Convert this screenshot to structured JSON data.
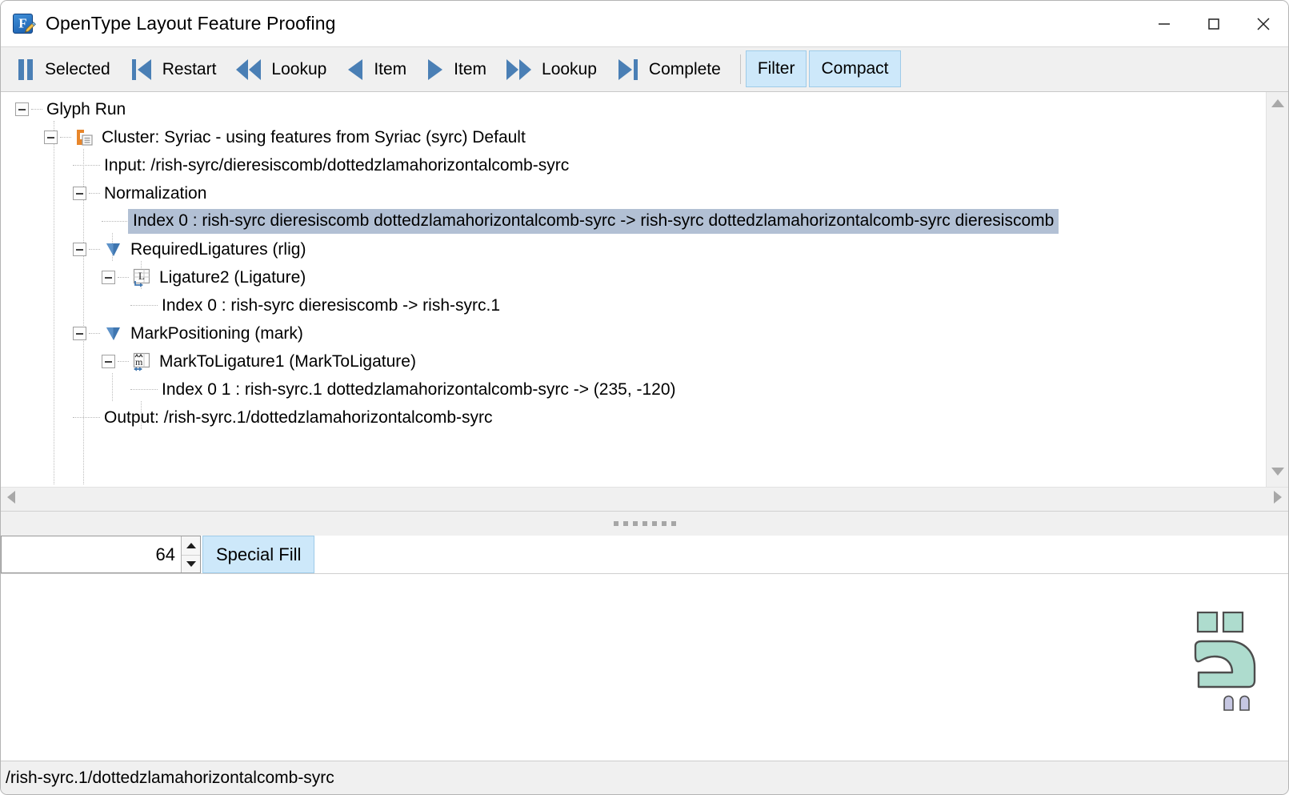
{
  "window": {
    "title": "OpenType Layout Feature Proofing",
    "icon": "font-pen-icon",
    "controls": {
      "minimize": "minimize-icon",
      "maximize": "maximize-icon",
      "close": "close-icon"
    }
  },
  "toolbar": {
    "buttons": [
      {
        "label": "Selected",
        "icon": "pause-bars-icon"
      },
      {
        "label": "Restart",
        "icon": "skip-back-icon"
      },
      {
        "label": "Lookup",
        "icon": "rewind-double-left-icon"
      },
      {
        "label": "Item",
        "icon": "step-left-icon"
      },
      {
        "label": "Item",
        "icon": "step-right-icon"
      },
      {
        "label": "Lookup",
        "icon": "fast-forward-double-right-icon"
      },
      {
        "label": "Complete",
        "icon": "skip-forward-icon"
      }
    ],
    "toggles": [
      {
        "label": "Filter",
        "active": true
      },
      {
        "label": "Compact",
        "active": true
      }
    ],
    "accent": "#4a7fb5",
    "toggle_bg": "#cde8fa",
    "toggle_border": "#9ecbe8"
  },
  "tree": {
    "selection_color": "#b2c0d4",
    "rows": [
      {
        "id": "glyph-run",
        "depth": 0,
        "expander": "minus",
        "icon": null,
        "text": "Glyph Run"
      },
      {
        "id": "cluster",
        "depth": 1,
        "expander": "minus",
        "icon": "cluster-icon",
        "text": "Cluster: Syriac - using features from Syriac (syrc) Default"
      },
      {
        "id": "input",
        "depth": 2,
        "expander": "none",
        "icon": null,
        "text": "Input: /rish-syrc/dieresiscomb/dottedzlamahorizontalcomb-syrc"
      },
      {
        "id": "normalization",
        "depth": 2,
        "expander": "minus",
        "icon": null,
        "text": "Normalization"
      },
      {
        "id": "normalization-idx0",
        "depth": 3,
        "expander": "none",
        "icon": null,
        "text": "Index 0 :  rish-syrc dieresiscomb dottedzlamahorizontalcomb-syrc ->  rish-syrc dottedzlamahorizontalcomb-syrc dieresiscomb",
        "selected": true
      },
      {
        "id": "rlig",
        "depth": 2,
        "expander": "minus",
        "icon": "feature-tag-icon",
        "text": "RequiredLigatures (rlig)"
      },
      {
        "id": "ligature2",
        "depth": 3,
        "expander": "minus",
        "icon": "ligature-table-icon",
        "text": "Ligature2 (Ligature)"
      },
      {
        "id": "ligature2-idx0",
        "depth": 4,
        "expander": "none",
        "icon": null,
        "text": "Index 0 : rish-syrc dieresiscomb  -> rish-syrc.1"
      },
      {
        "id": "mark",
        "depth": 2,
        "expander": "minus",
        "icon": "feature-tag-icon",
        "text": "MarkPositioning (mark)"
      },
      {
        "id": "marktoligature1",
        "depth": 3,
        "expander": "minus",
        "icon": "mark-table-icon",
        "text": "MarkToLigature1 (MarkToLigature)"
      },
      {
        "id": "mtl-idx01",
        "depth": 4,
        "expander": "none",
        "icon": null,
        "text": "Index 0 1 : rish-syrc.1 dottedzlamahorizontalcomb-syrc -> (235, -120)"
      },
      {
        "id": "output",
        "depth": 2,
        "expander": "none",
        "icon": null,
        "text": "Output: /rish-syrc.1/dottedzlamahorizontalcomb-syrc"
      }
    ]
  },
  "bottom": {
    "size_value": "64",
    "size_placeholder": "",
    "special_fill_label": "Special Fill"
  },
  "preview": {
    "glyph_name": "rish-syrc.1 + dottedzlamahorizontalcomb-syrc",
    "glyph_fill": "#aedcce",
    "glyph_stroke": "#4d4d4d",
    "mark_fill": "#c6c7e2"
  },
  "statusbar": {
    "text": "/rish-syrc.1/dottedzlamahorizontalcomb-syrc"
  }
}
